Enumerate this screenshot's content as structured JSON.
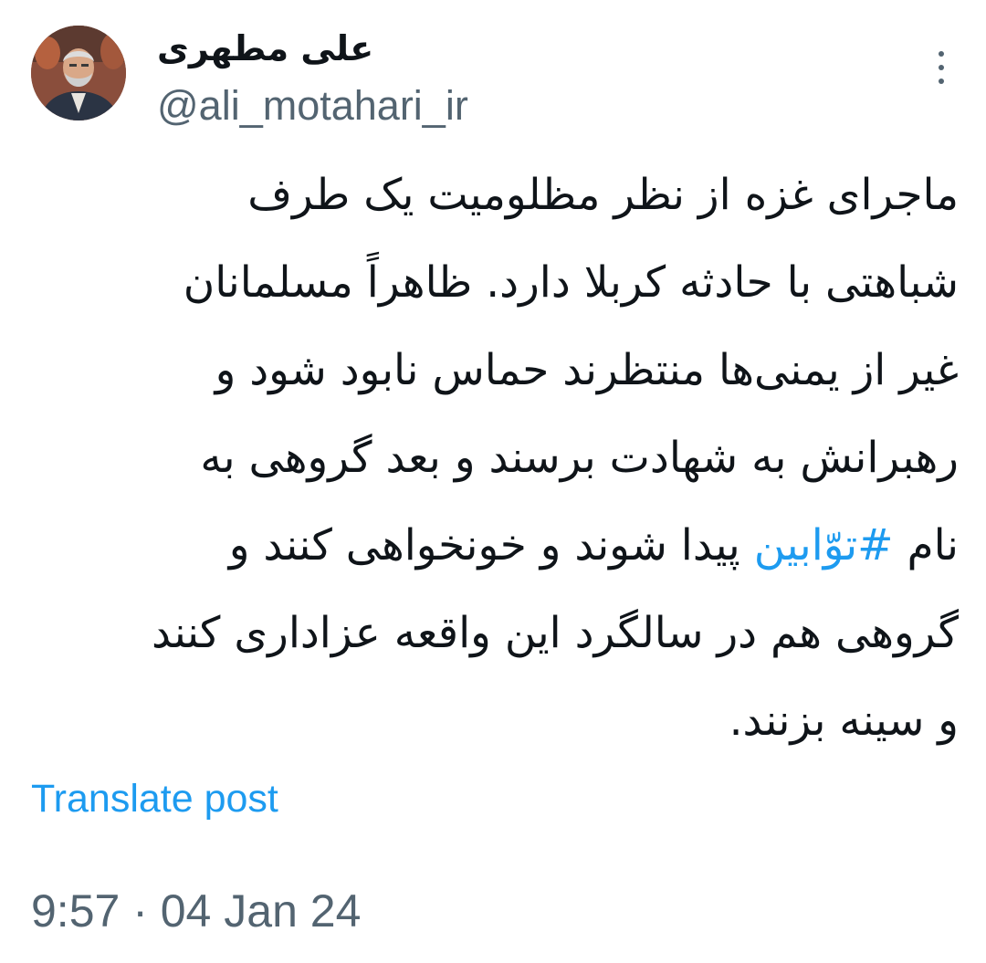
{
  "author": {
    "display_name": "علی مطهری",
    "handle": "@ali_motahari_ir",
    "avatar_icon": "profile-photo"
  },
  "post": {
    "lines": [
      {
        "segments": [
          {
            "text": "ماجرای غزه از نظر مظلومیت یک طرف",
            "hashtag": false
          }
        ]
      },
      {
        "segments": [
          {
            "text": "شباهتی با حادثه کربلا دارد. ظاهراً مسلمانان",
            "hashtag": false
          }
        ]
      },
      {
        "segments": [
          {
            "text": "غیر از یمنی‌ها منتظرند حماس نابود شود و",
            "hashtag": false
          }
        ]
      },
      {
        "segments": [
          {
            "text": "رهبرانش به شهادت برسند و بعد گروهی به",
            "hashtag": false
          }
        ]
      },
      {
        "segments": [
          {
            "text": "نام ",
            "hashtag": false
          },
          {
            "text": "#توّابین",
            "hashtag": true
          },
          {
            "text": " پیدا شوند و خونخواهی کنند و",
            "hashtag": false
          }
        ]
      },
      {
        "segments": [
          {
            "text": "گروهی هم در سالگرد این واقعه عزاداری کنند",
            "hashtag": false
          }
        ]
      },
      {
        "segments": [
          {
            "text": "و سینه بزنند.",
            "hashtag": false
          }
        ]
      }
    ],
    "translate_label": "Translate post",
    "timestamp": "9:57 · 04 Jan 24"
  },
  "colors": {
    "link": "#1d9bf0",
    "secondary_text": "#536471",
    "primary_text": "#0f1419"
  },
  "icons": {
    "more": "more-vertical-icon"
  }
}
